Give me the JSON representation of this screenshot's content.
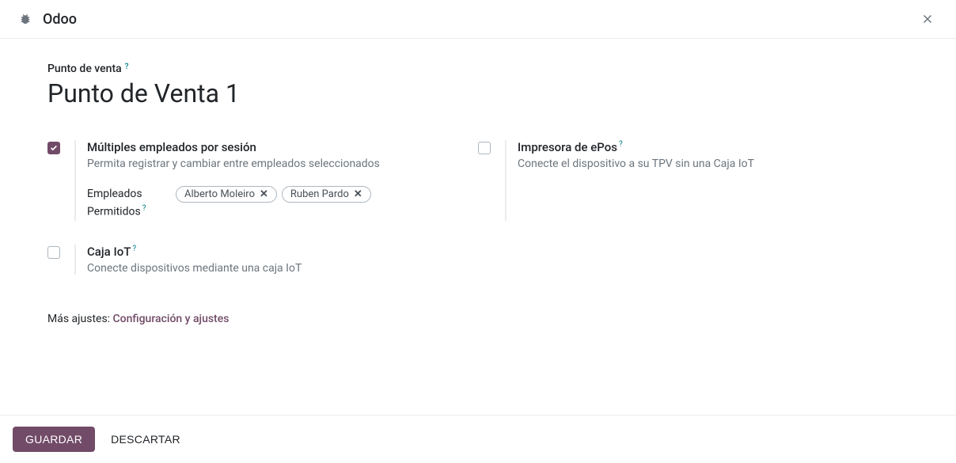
{
  "header": {
    "app_title": "Odoo"
  },
  "breadcrumb": {
    "label": "Punto de venta"
  },
  "page": {
    "title": "Punto de Venta 1"
  },
  "settings": {
    "multi_employees": {
      "checked": true,
      "title": "Múltiples empleados por sesión",
      "description": "Permita registrar y cambiar entre empleados seleccionados",
      "allowed_label": "Empleados Permitidos",
      "tags": [
        "Alberto Moleiro",
        "Ruben Pardo"
      ]
    },
    "epos_printer": {
      "checked": false,
      "title": "Impresora de ePos",
      "description": "Conecte el dispositivo a su TPV sin una Caja IoT"
    },
    "iot_box": {
      "checked": false,
      "title": "Caja IoT",
      "description": "Conecte dispositivos mediante una caja IoT"
    }
  },
  "more_settings": {
    "prefix": "Más ajustes: ",
    "link": "Configuración y ajustes"
  },
  "footer": {
    "save": "GUARDAR",
    "discard": "DESCARTAR"
  },
  "glyphs": {
    "help": "?",
    "remove": "✕"
  }
}
